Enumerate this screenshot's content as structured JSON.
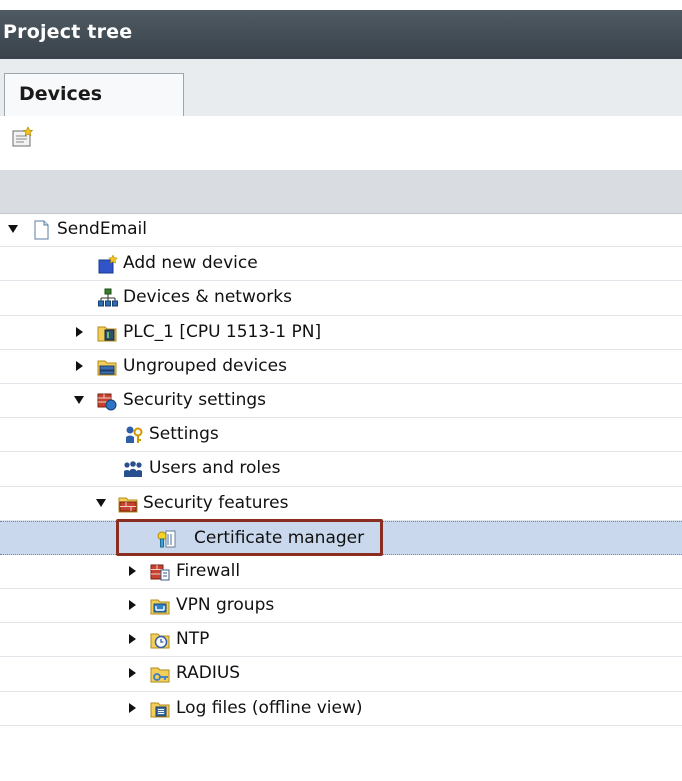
{
  "panel": {
    "title": "Project tree"
  },
  "tabs": [
    {
      "label": "Devices"
    }
  ],
  "tree": {
    "items": [
      {
        "label": "SendEmail",
        "icon": "project-icon",
        "expanded": true
      },
      {
        "label": "Add new device",
        "icon": "add-device-icon"
      },
      {
        "label": "Devices & networks",
        "icon": "network-icon"
      },
      {
        "label": "PLC_1 [CPU 1513-1 PN]",
        "icon": "plc-icon",
        "expanded": false
      },
      {
        "label": "Ungrouped devices",
        "icon": "ungrouped-devices-icon",
        "expanded": false
      },
      {
        "label": "Security settings",
        "icon": "security-settings-icon",
        "expanded": true
      },
      {
        "label": "Settings",
        "icon": "settings-key-icon"
      },
      {
        "label": "Users and roles",
        "icon": "users-icon"
      },
      {
        "label": "Security features",
        "icon": "firewall-folder-icon",
        "expanded": true
      },
      {
        "label": "Certificate manager",
        "icon": "certificate-icon",
        "selected": true
      },
      {
        "label": "Firewall",
        "icon": "firewall-icon",
        "expanded": false
      },
      {
        "label": "VPN groups",
        "icon": "vpn-icon",
        "expanded": false
      },
      {
        "label": "NTP",
        "icon": "ntp-clock-icon",
        "expanded": false
      },
      {
        "label": "RADIUS",
        "icon": "radius-key-icon",
        "expanded": false
      },
      {
        "label": "Log files (offline view)",
        "icon": "log-files-icon",
        "expanded": false
      }
    ]
  },
  "colors": {
    "titlebar": "#434d56",
    "selection": "#c9d8ec",
    "highlight": "#8b2e22"
  }
}
